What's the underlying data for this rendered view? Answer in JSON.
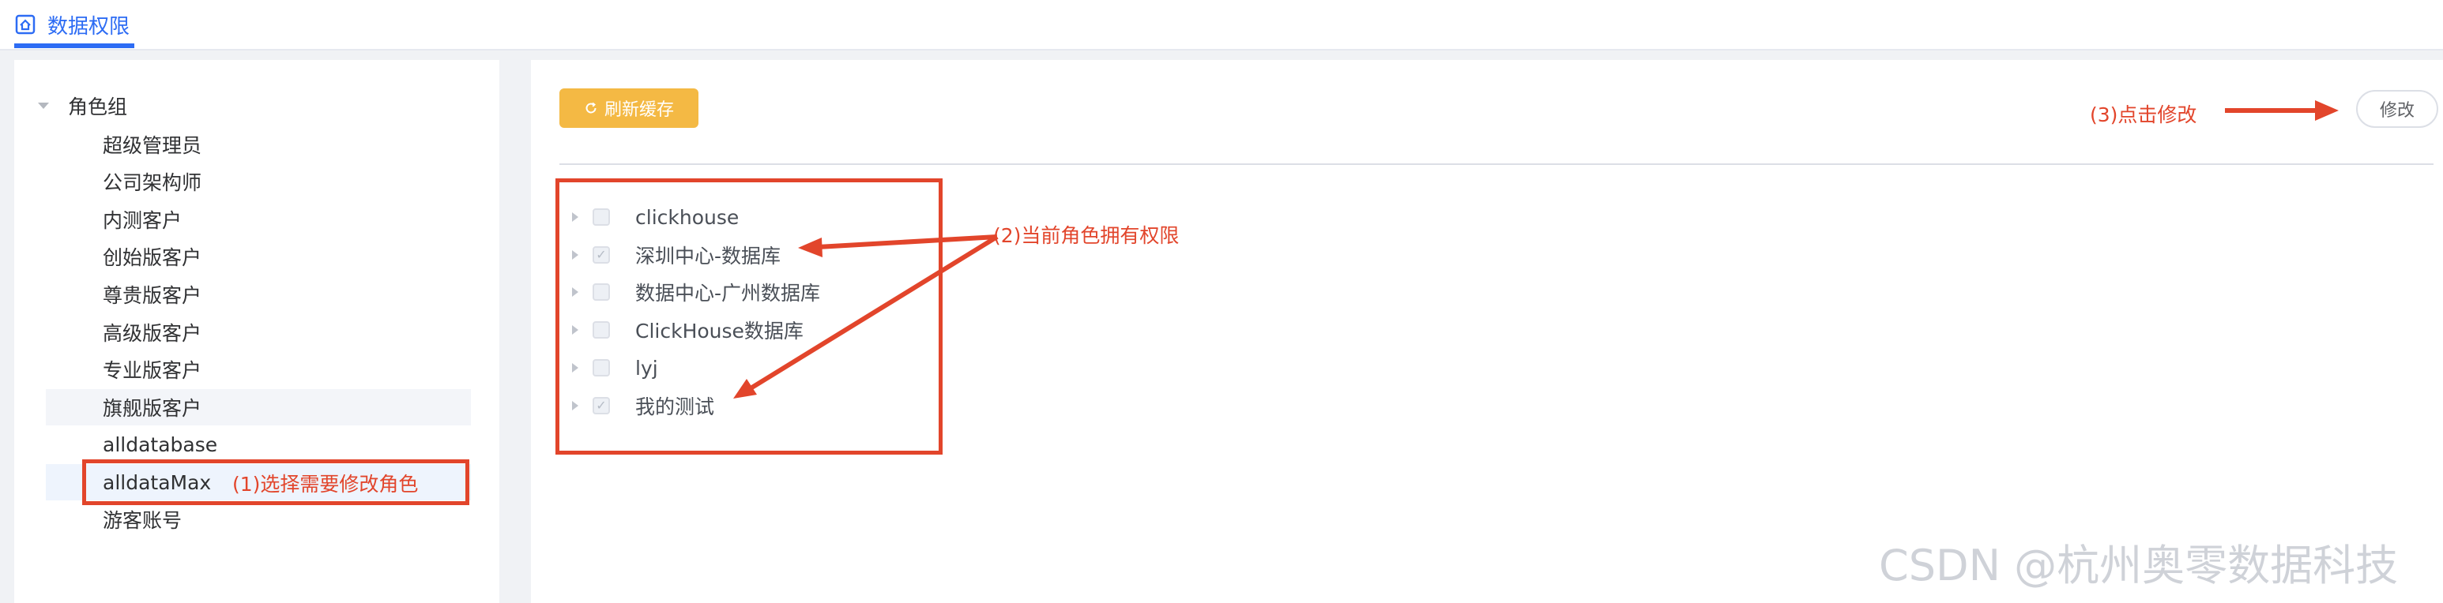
{
  "tab": {
    "label": "数据权限",
    "icon": "home-icon"
  },
  "tree": {
    "root_label": "角色组",
    "roles": [
      {
        "label": "超级管理员"
      },
      {
        "label": "公司架构师"
      },
      {
        "label": "内测客户"
      },
      {
        "label": "创始版客户"
      },
      {
        "label": "尊贵版客户"
      },
      {
        "label": "高级版客户"
      },
      {
        "label": "专业版客户"
      },
      {
        "label": "旗舰版客户"
      },
      {
        "label": "alldatabase"
      },
      {
        "label": "alldataMax"
      },
      {
        "label": "游客账号"
      }
    ],
    "hovered_role": "旗舰版客户",
    "selected_role": "alldataMax"
  },
  "toolbar": {
    "refresh_label": "刷新缓存",
    "refresh_icon": "refresh-icon",
    "edit_label": "修改"
  },
  "databases": [
    {
      "label": "clickhouse",
      "checked": false
    },
    {
      "label": "深圳中心-数据库",
      "checked": true
    },
    {
      "label": "数据中心-广州数据库",
      "checked": false
    },
    {
      "label": "ClickHouse数据库",
      "checked": false
    },
    {
      "label": "lyj",
      "checked": false
    },
    {
      "label": "我的测试",
      "checked": true
    }
  ],
  "annotations": {
    "step1": "(1)选择需要修改角色",
    "step2": "(2)当前角色拥有权限",
    "step3": "(3)点击修改"
  },
  "colors": {
    "accent": "#2d6cf4",
    "warning_button": "#f4b944",
    "annotation_red": "#e2452b"
  },
  "watermark": "CSDN @杭州奥零数据科技"
}
